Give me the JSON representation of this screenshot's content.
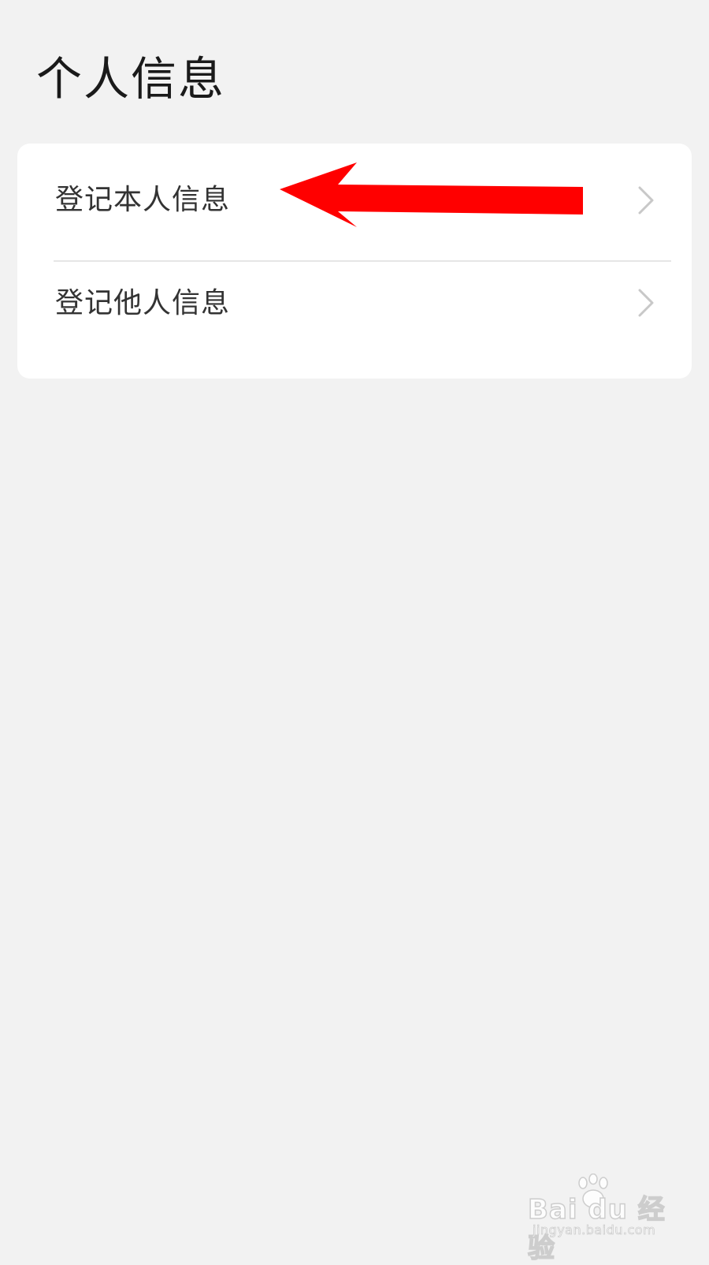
{
  "header": {
    "title": "个人信息"
  },
  "menu": {
    "items": [
      {
        "label": "登记本人信息"
      },
      {
        "label": "登记他人信息"
      }
    ]
  },
  "annotation": {
    "arrow_color": "#ff0000"
  },
  "watermark": {
    "brand": "Bai du 经验",
    "url": "jingyan.baidu.com"
  },
  "colors": {
    "background": "#f2f2f2",
    "card": "#ffffff",
    "divider": "#e6e6e6",
    "chevron": "#c8c8c8"
  }
}
